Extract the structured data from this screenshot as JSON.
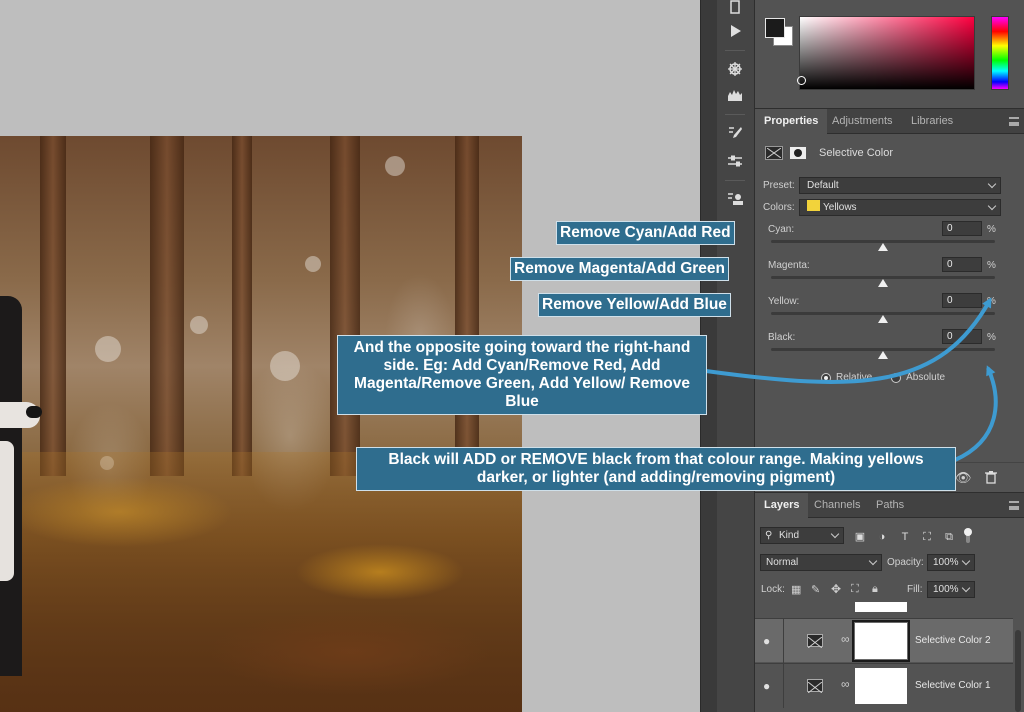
{
  "properties_panel": {
    "tabs": [
      "Properties",
      "Adjustments",
      "Libraries"
    ],
    "adjustment_title": "Selective Color",
    "preset_label": "Preset:",
    "preset_value": "Default",
    "colors_label": "Colors:",
    "colors_value": "Yellows",
    "sliders": [
      {
        "label": "Cyan:",
        "value": "0",
        "unit": "%"
      },
      {
        "label": "Magenta:",
        "value": "0",
        "unit": "%"
      },
      {
        "label": "Yellow:",
        "value": "0",
        "unit": "%"
      },
      {
        "label": "Black:",
        "value": "0",
        "unit": "%"
      }
    ],
    "method_relative": "Relative",
    "method_absolute": "Absolute"
  },
  "layers_panel": {
    "tabs": [
      "Layers",
      "Channels",
      "Paths"
    ],
    "filter_kind": "Kind",
    "blend_mode": "Normal",
    "opacity_label": "Opacity:",
    "opacity_value": "100%",
    "lock_label": "Lock:",
    "fill_label": "Fill:",
    "fill_value": "100%",
    "layers": [
      {
        "name": "Selective Color 2",
        "selected": true
      },
      {
        "name": "Selective Color 1",
        "selected": false
      }
    ]
  },
  "annotations": {
    "cyan": "Remove Cyan/Add Red",
    "magenta": "Remove Magenta/Add Green",
    "yellow": "Remove Yellow/Add Blue",
    "opposite": "And the opposite going toward the right-hand side. Eg: Add Cyan/Remove Red, Add Magenta/Remove Green, Add Yellow/ Remove Blue",
    "black": "Black will ADD or REMOVE black from that colour range. Making yellows darker, or lighter (and adding/removing pigment)"
  },
  "colors": {
    "annotation_bg": "#2f6d8e",
    "arrow": "#3e9bd1",
    "panel_bg": "#535353",
    "yellow_chip": "#f2d33b"
  }
}
